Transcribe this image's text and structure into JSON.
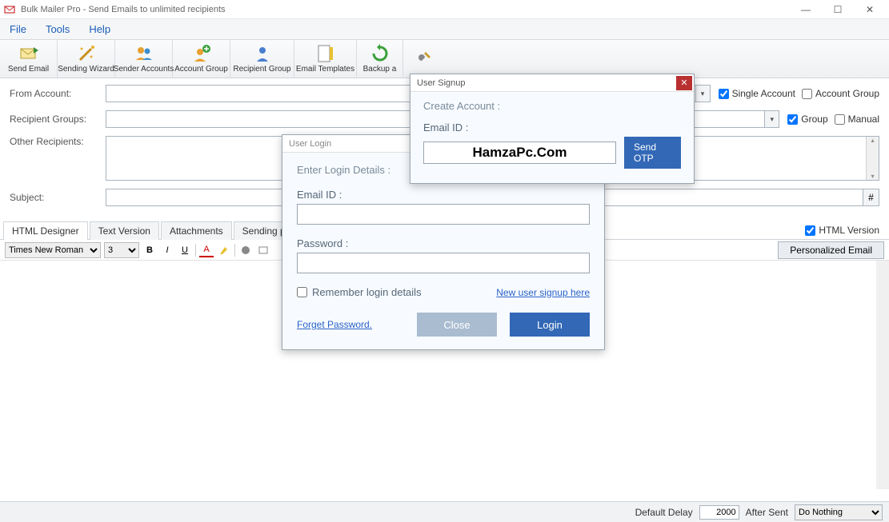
{
  "window": {
    "title": "Bulk Mailer Pro - Send Emails to unlimited recipients"
  },
  "menu": {
    "file": "File",
    "tools": "Tools",
    "help": "Help"
  },
  "toolbar": {
    "send_email": "Send Email",
    "sending_wizard": "Sending Wizard",
    "sender_accounts": "Sender Accounts",
    "account_group": "Account Group",
    "recipient_group": "Recipient Group",
    "email_templates": "Email Templates",
    "backup": "Backup a",
    "settings": ""
  },
  "form": {
    "from_account_label": "From Account:",
    "recipient_groups_label": "Recipient Groups:",
    "other_recipients_label": "Other Recipients:",
    "subject_label": "Subject:",
    "single_account": "Single Account",
    "account_group": "Account Group",
    "group": "Group",
    "manual": "Manual",
    "hash": "#"
  },
  "tabs": {
    "html_designer": "HTML Designer",
    "text_version": "Text Version",
    "attachments": "Attachments",
    "sending_progress": "Sending progress",
    "html_version": "HTML Version"
  },
  "editor": {
    "font": "Times New Roman",
    "size": "3",
    "personalized": "Personalized Email"
  },
  "login_dialog": {
    "title": "User Login",
    "legend": "Enter Login Details :",
    "email_label": "Email ID :",
    "password_label": "Password :",
    "remember": "Remember login details",
    "signup_link": "New user signup here",
    "forgot": "Forget Password.",
    "close": "Close",
    "login": "Login"
  },
  "signup_dialog": {
    "title": "User Signup",
    "legend": "Create Account :",
    "email_label": "Email ID :",
    "email_value": "HamzaPc.Com",
    "send_otp": "Send OTP"
  },
  "status": {
    "default_delay_label": "Default Delay",
    "default_delay_value": "2000",
    "after_sent_label": "After Sent",
    "after_sent_value": "Do Nothing"
  }
}
